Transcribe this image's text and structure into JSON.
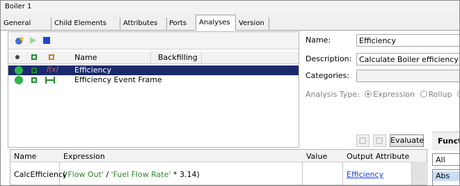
{
  "window": {
    "title": "Boiler 1"
  },
  "tabs": [
    {
      "label": "General"
    },
    {
      "label": "Child Elements"
    },
    {
      "label": "Attributes"
    },
    {
      "label": "Ports"
    },
    {
      "label": "Analyses",
      "active": true
    },
    {
      "label": "Version"
    }
  ],
  "analyses_list": {
    "columns": [
      "Name",
      "Backfilling"
    ],
    "rows": [
      {
        "name": "Efficiency",
        "icon": "expression-icon",
        "selected": true
      },
      {
        "name": "Efficiency Event Frame",
        "icon": "event-frame-icon",
        "selected": false
      }
    ]
  },
  "form": {
    "name_label": "Name:",
    "name_value": "Efficiency",
    "description_label": "Description:",
    "description_value": "Calculate Boiler efficiency",
    "categories_label": "Categories:",
    "categories_value": "",
    "analysis_type_label": "Analysis Type:",
    "analysis_types": [
      "Expression",
      "Rollup"
    ]
  },
  "evaluate_button": "Evaluate",
  "expression_grid": {
    "columns": [
      "Name",
      "Expression",
      "Value",
      "Output Attribute"
    ],
    "rows": [
      {
        "name": "CalcEfficiency",
        "expression_prefix": "(",
        "flow_out": "'Flow Out'",
        "op1": " / ",
        "fuel_flow": "'Fuel Flow Rate'",
        "op2": " * 3.14)",
        "value": "",
        "output": "Efficiency"
      }
    ]
  },
  "functions_panel": {
    "title": "Functi",
    "filter": "All",
    "items": [
      "Abs"
    ]
  },
  "colors": {
    "selection": "#1a2a6c",
    "status_green": "#2db54a",
    "link": "#1c3fd6",
    "attribute_green": "#2b8a2b"
  }
}
